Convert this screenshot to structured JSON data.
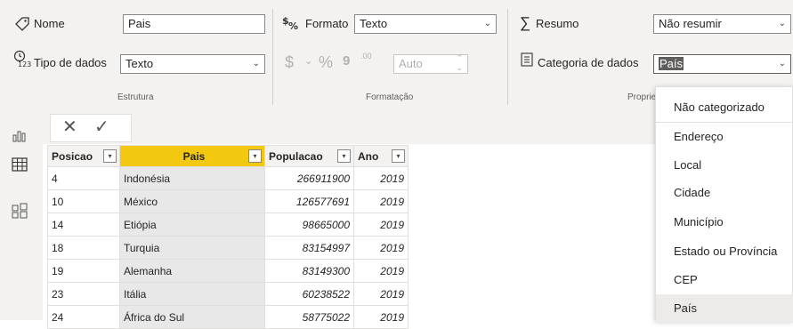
{
  "ribbon": {
    "estrutura": {
      "group_label": "Estrutura",
      "nome_label": "Nome",
      "nome_value": "Pais",
      "tipo_label": "Tipo de dados",
      "tipo_value": "Texto"
    },
    "formatacao": {
      "group_label": "Formatação",
      "formato_label": "Formato",
      "formato_value": "Texto",
      "currency_symbol": "$",
      "percent_symbol": "%",
      "comma_symbol": "9",
      "decimals_symbol": ".00",
      "auto_value": "Auto"
    },
    "propriedades": {
      "group_label": "Proprie",
      "resumo_label": "Resumo",
      "resumo_value": "Não resumir",
      "categoria_label": "Categoria de dados",
      "categoria_value": "País"
    }
  },
  "formula_bar": {
    "cancel": "✕",
    "confirm": "✓"
  },
  "table": {
    "columns": [
      "Posicao",
      "Pais",
      "Populacao",
      "Ano"
    ],
    "rows": [
      [
        "4",
        "Indonésia",
        "266911900",
        "2019"
      ],
      [
        "10",
        "México",
        "126577691",
        "2019"
      ],
      [
        "14",
        "Etiópia",
        "98665000",
        "2019"
      ],
      [
        "18",
        "Turquia",
        "83154997",
        "2019"
      ],
      [
        "19",
        "Alemanha",
        "83149300",
        "2019"
      ],
      [
        "23",
        "Itália",
        "60238522",
        "2019"
      ],
      [
        "24",
        "África do Sul",
        "58775022",
        "2019"
      ]
    ]
  },
  "dropdown": {
    "items": [
      "Não categorizado",
      "Endereço",
      "Local",
      "Cidade",
      "Município",
      "Estado ou Província",
      "CEP",
      "País"
    ],
    "active_index": 7
  }
}
